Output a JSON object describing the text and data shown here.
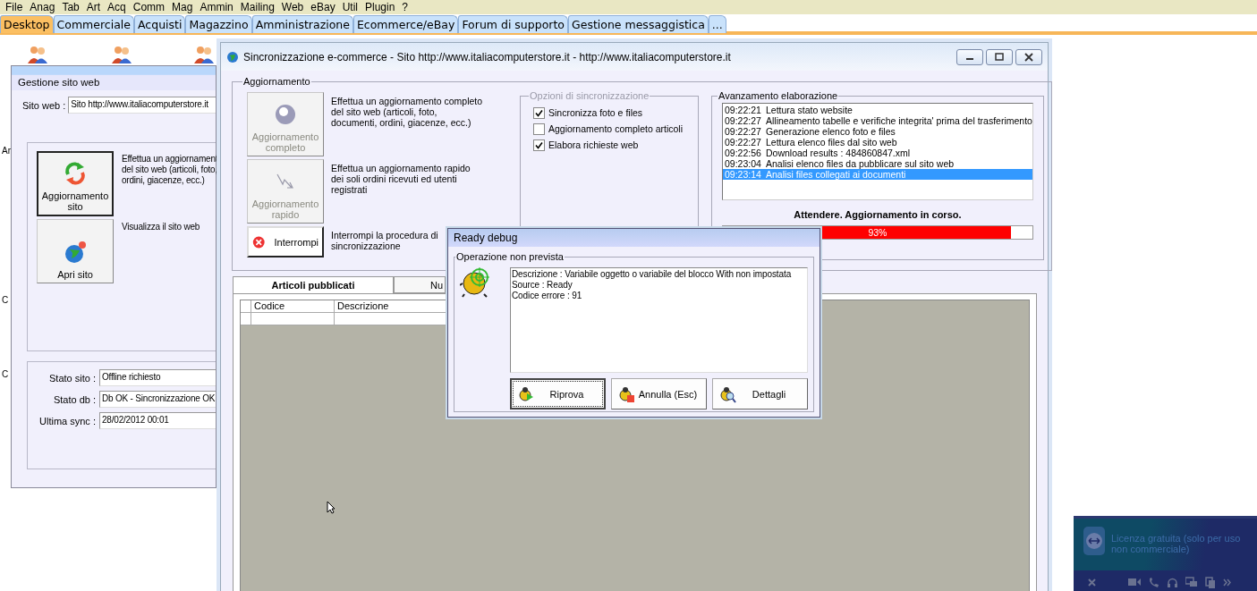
{
  "menu": [
    "File",
    "Anag",
    "Tab",
    "Art",
    "Acq",
    "Comm",
    "Mag",
    "Ammin",
    "Mailing",
    "Web",
    "eBay",
    "Util",
    "Plugin",
    "?"
  ],
  "tabs": [
    {
      "label": "Desktop",
      "selected": true
    },
    {
      "label": "Commerciale",
      "selected": false
    },
    {
      "label": "Acquisti",
      "selected": false
    },
    {
      "label": "Magazzino",
      "selected": false
    },
    {
      "label": "Amministrazione",
      "selected": false
    },
    {
      "label": "Ecommerce/eBay",
      "selected": false
    },
    {
      "label": "Forum di supporto",
      "selected": false
    },
    {
      "label": "Gestione messaggistica",
      "selected": false
    },
    {
      "label": "...",
      "selected": false
    }
  ],
  "desktop_labels": [
    "Ar",
    "C",
    "C"
  ],
  "site_window": {
    "title": "Gestione sito web",
    "site_label": "Sito web :",
    "site_value": "Sito http://www.italiacomputerstore.it",
    "actions": [
      {
        "label": "Aggiornamento sito",
        "focused": true,
        "description": [
          "Effettua un aggiornament",
          "del sito web (articoli, foto,",
          "ordini, giacenze, ecc.)"
        ]
      },
      {
        "label": "Apri sito",
        "focused": false,
        "description": [
          "Visualizza il sito web"
        ]
      }
    ],
    "status": [
      {
        "label": "Stato sito :",
        "value": "Offline richiesto"
      },
      {
        "label": "Stato db :",
        "value": "Db OK - Sincronizzazione OK"
      },
      {
        "label": "Ultima sync :",
        "value": "28/02/2012 00:01"
      }
    ]
  },
  "sync_window": {
    "title": "Sincronizzazione e-commerce - Sito http://www.italiacomputerstore.it - http://www.italiacomputerstore.it",
    "update_group": "Aggiornamento",
    "actions": [
      {
        "kind": "full",
        "label": "Aggiornamento completo",
        "disabled": true,
        "description": "Effettua un aggiornamento completo del sito web (articoli, foto, documenti, ordini, giacenze, ecc.)"
      },
      {
        "kind": "quick",
        "label": "Aggiornamento rapido",
        "disabled": true,
        "description": "Effettua un aggiornamento rapido dei soli ordini ricevuti ed utenti registrati"
      },
      {
        "kind": "stop",
        "label": "Interrompi",
        "disabled": false,
        "description": "Interrompi la procedura di sincronizzazione"
      }
    ],
    "options": {
      "title": "Opzioni di sincronizzazione",
      "disabled": true,
      "items": [
        {
          "label": "Sincronizza foto e files",
          "checked": true
        },
        {
          "label": "Aggiornamento completo articoli",
          "checked": false
        },
        {
          "label": "Elabora richieste web",
          "checked": true
        }
      ]
    },
    "progress": {
      "title": "Avanzamento elaborazione",
      "log": [
        {
          "time": "09:22:21",
          "text": "Lettura stato website",
          "selected": false
        },
        {
          "time": "09:22:27",
          "text": "Allineamento tabelle e verifiche integrita' prima del trasferimento",
          "selected": false
        },
        {
          "time": "09:22:27",
          "text": "Generazione elenco foto e files",
          "selected": false
        },
        {
          "time": "09:22:27",
          "text": "Lettura elenco files dal sito web",
          "selected": false
        },
        {
          "time": "09:22:56",
          "text": "Download results : 484860847.xml",
          "selected": false
        },
        {
          "time": "09:23:04",
          "text": "Analisi elenco files da pubblicare sul sito web",
          "selected": false
        },
        {
          "time": "09:23:14",
          "text": "Analisi files collegati ai documenti",
          "selected": true
        }
      ],
      "status": "Attendere. Aggiornamento in corso.",
      "level": 0.93,
      "reading": "93%"
    },
    "tabs": [
      {
        "label": "Articoli pubblicati",
        "selected": true
      },
      {
        "label": "Nu",
        "selected": false
      }
    ],
    "table": {
      "columns": [
        "Codice",
        "Descrizione"
      ]
    }
  },
  "dialog": {
    "title": "Ready debug",
    "group": "Operazione non prevista",
    "message": [
      "Descrizione : Variabile oggetto o variabile del blocco With non impostata",
      "Source : Ready",
      "Codice errore : 91"
    ],
    "buttons": [
      {
        "kind": "retry",
        "label": "Riprova",
        "focused": true
      },
      {
        "kind": "cancel",
        "label": "Annulla (Esc)",
        "focused": false
      },
      {
        "kind": "details",
        "label": "Dettagli",
        "focused": false
      }
    ]
  },
  "remote_popup": {
    "text": "Licenza gratuita (solo per uso non commerciale)"
  }
}
